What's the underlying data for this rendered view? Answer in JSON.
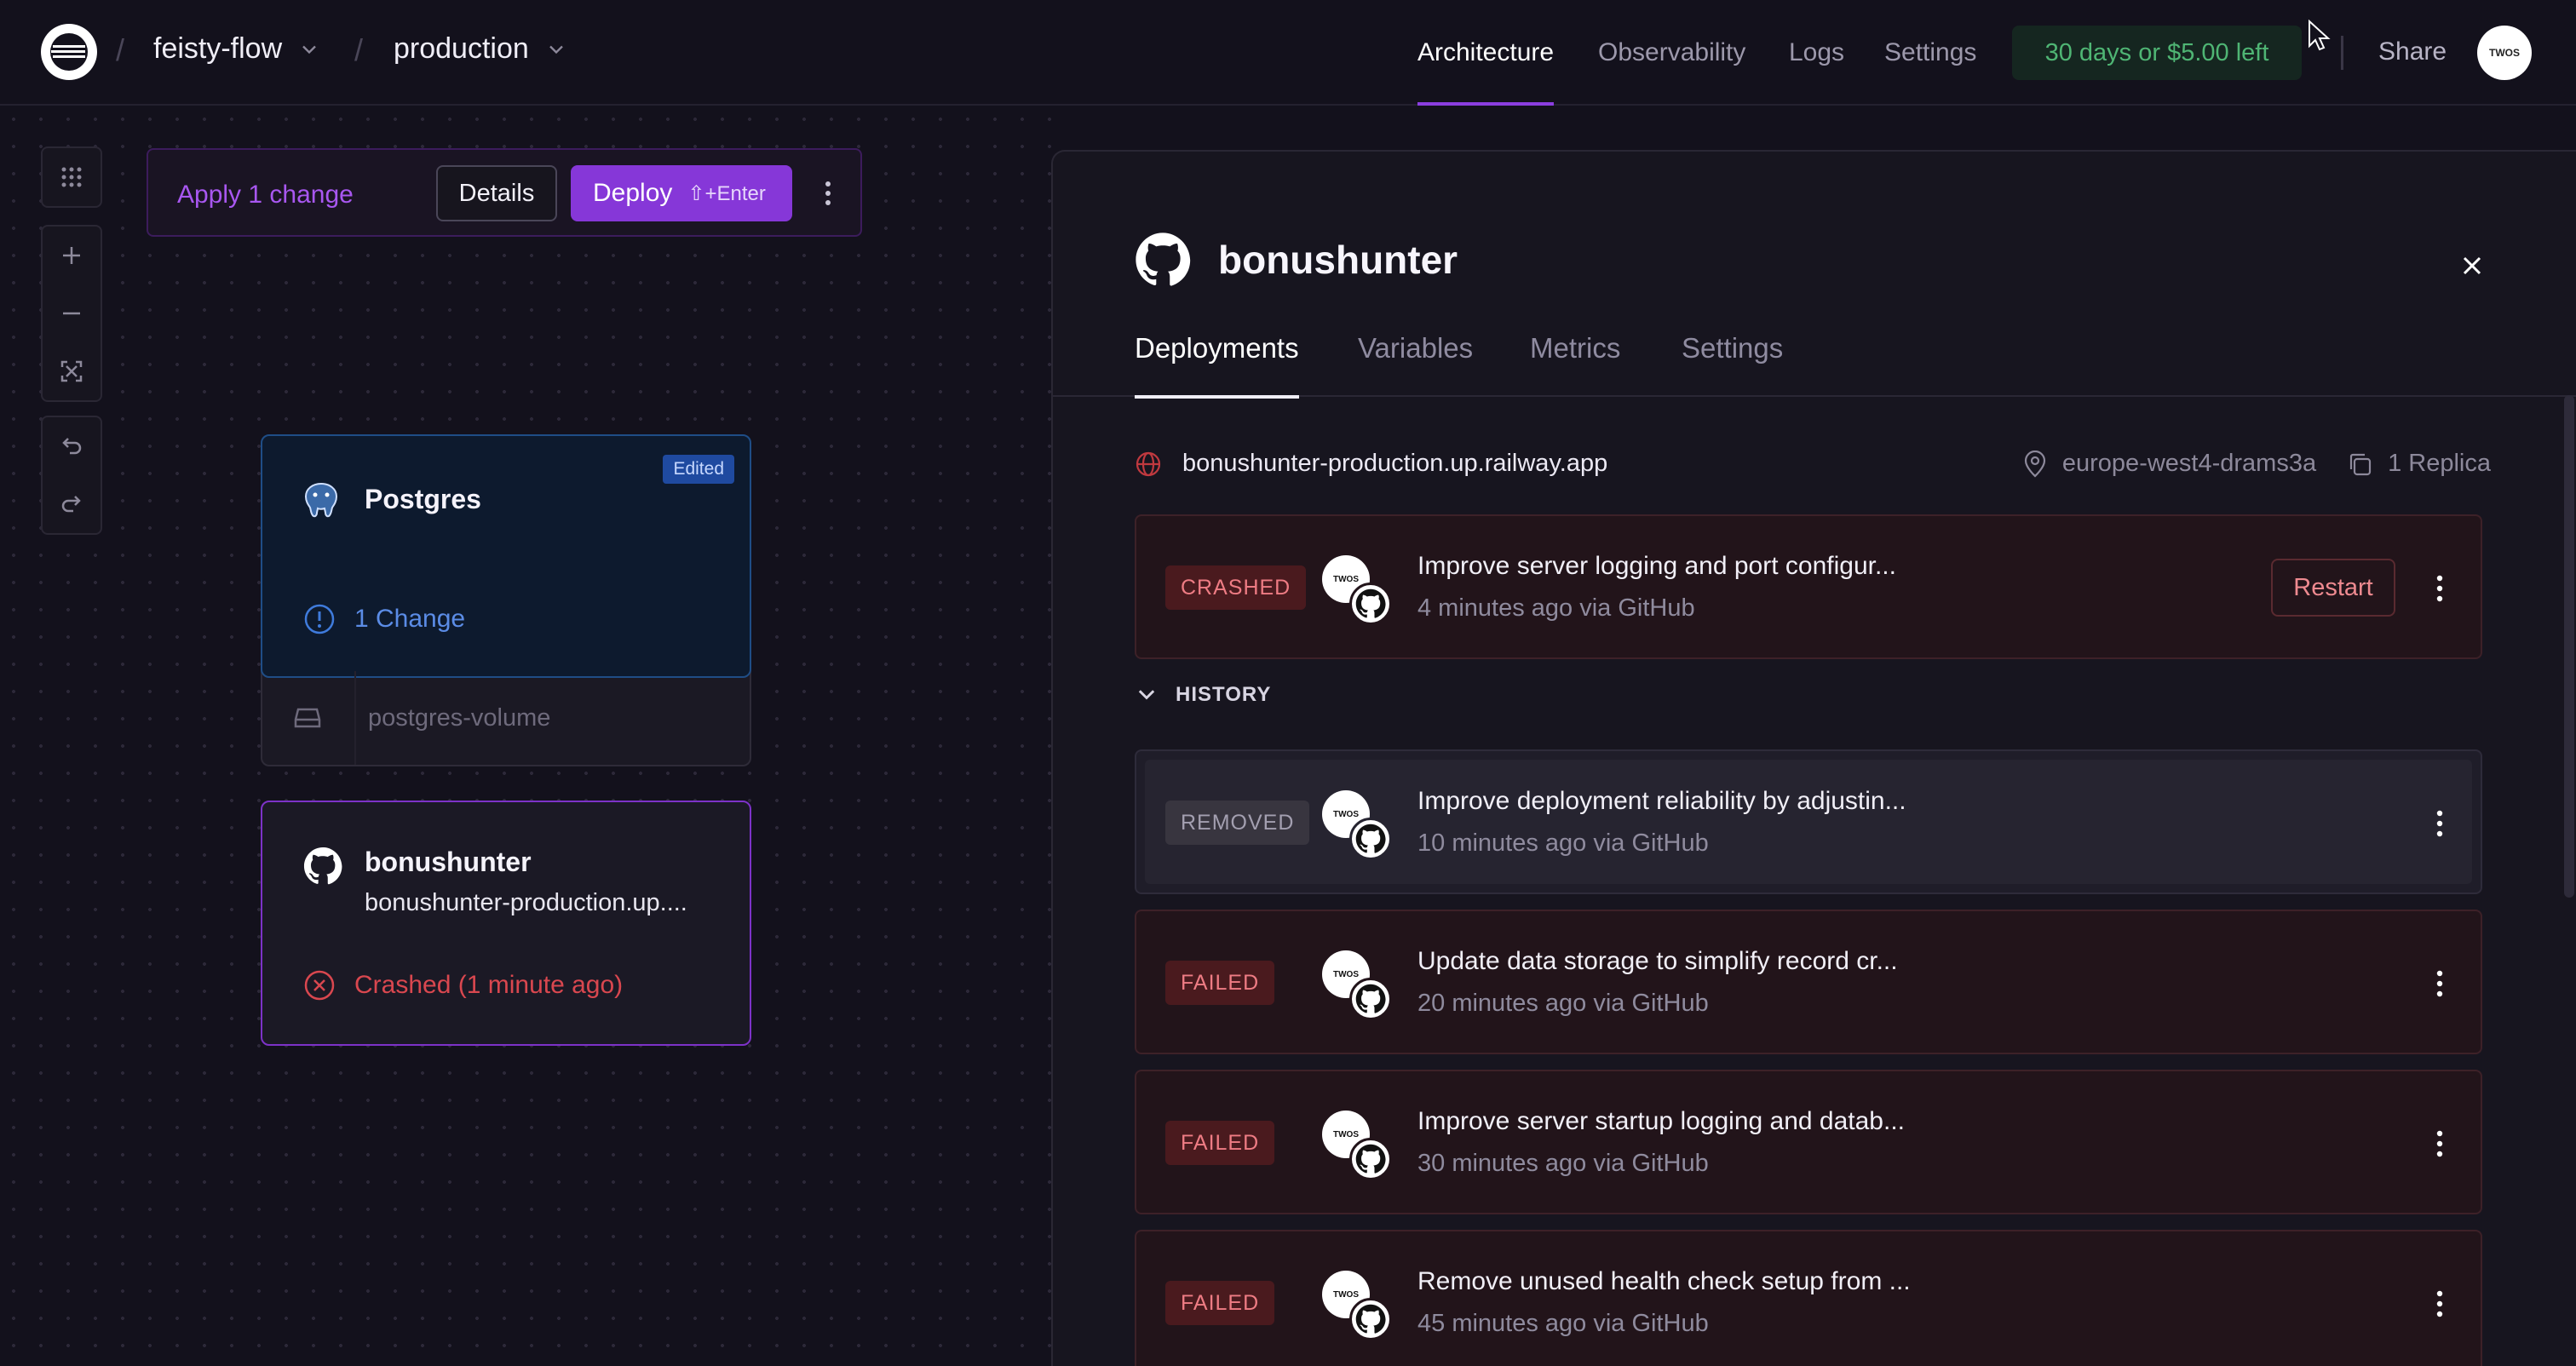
{
  "topbar": {
    "project": "feisty-flow",
    "environment": "production",
    "nav": [
      "Architecture",
      "Observability",
      "Logs",
      "Settings"
    ],
    "active_nav": "Architecture",
    "trial": "30 days or $5.00 left",
    "share": "Share",
    "avatar_text": "TWOS"
  },
  "canvas": {
    "apply_label": "Apply 1 change",
    "details_label": "Details",
    "deploy_label": "Deploy",
    "deploy_shortcut": "⇧+Enter",
    "postgres": {
      "title": "Postgres",
      "badge": "Edited",
      "change": "1 Change",
      "volume": "postgres-volume"
    },
    "service": {
      "title": "bonushunter",
      "subtitle": "bonushunter-production.up....",
      "status": "Crashed (1 minute ago)"
    }
  },
  "panel": {
    "title": "bonushunter",
    "tabs": [
      "Deployments",
      "Variables",
      "Metrics",
      "Settings"
    ],
    "url": "bonushunter-production.up.railway.app",
    "region": "europe-west4-drams3a",
    "replicas": "1 Replica",
    "history_label": "HISTORY",
    "restart_label": "Restart",
    "active_deployment": {
      "status": "CRASHED",
      "message": "Improve server logging and port configur...",
      "time": "4 minutes ago via GitHub"
    },
    "history": [
      {
        "status": "REMOVED",
        "message": "Improve deployment reliability by adjustin...",
        "time": "10 minutes ago via GitHub"
      },
      {
        "status": "FAILED",
        "message": "Update data storage to simplify record cr...",
        "time": "20 minutes ago via GitHub"
      },
      {
        "status": "FAILED",
        "message": "Improve server startup logging and datab...",
        "time": "30 minutes ago via GitHub"
      },
      {
        "status": "FAILED",
        "message": "Remove unused health check setup from ...",
        "time": "45 minutes ago via GitHub"
      }
    ]
  },
  "colors": {
    "accent": "#8637d8",
    "crashed": "#ee7c84",
    "success": "#4fb574",
    "edited": "#1f4aa0"
  }
}
